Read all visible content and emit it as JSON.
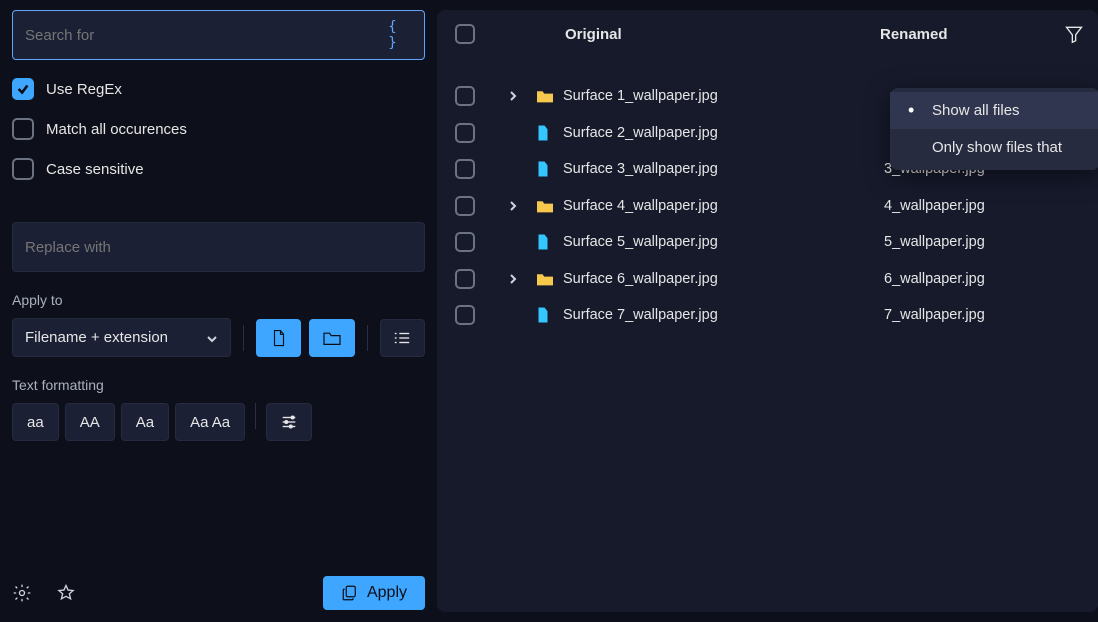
{
  "search": {
    "placeholder": "Search for"
  },
  "options": {
    "regex_label": "Use RegEx",
    "regex_checked": true,
    "matchall_label": "Match all occurences",
    "case_label": "Case sensitive"
  },
  "replace": {
    "placeholder": "Replace with"
  },
  "applyto": {
    "label": "Apply to",
    "value": "Filename + extension"
  },
  "textfmt": {
    "label": "Text formatting",
    "btns": [
      "aa",
      "AA",
      "Aa",
      "Aa Aa"
    ]
  },
  "header": {
    "original": "Original",
    "renamed": "Renamed"
  },
  "filter_menu": {
    "selected": "Show all files",
    "other": "Only show files that"
  },
  "rows": [
    {
      "folder": true,
      "chev": true,
      "orig": "Surface 1_wallpaper.jpg",
      "ren": ""
    },
    {
      "folder": false,
      "chev": false,
      "orig": "Surface 2_wallpaper.jpg",
      "ren": ""
    },
    {
      "folder": false,
      "chev": false,
      "orig": "Surface 3_wallpaper.jpg",
      "ren": "3_wallpaper.jpg"
    },
    {
      "folder": true,
      "chev": true,
      "orig": "Surface 4_wallpaper.jpg",
      "ren": "4_wallpaper.jpg"
    },
    {
      "folder": false,
      "chev": false,
      "orig": "Surface 5_wallpaper.jpg",
      "ren": "5_wallpaper.jpg"
    },
    {
      "folder": true,
      "chev": true,
      "orig": "Surface 6_wallpaper.jpg",
      "ren": "6_wallpaper.jpg"
    },
    {
      "folder": false,
      "chev": false,
      "orig": "Surface 7_wallpaper.jpg",
      "ren": "7_wallpaper.jpg"
    }
  ],
  "apply_button": "Apply"
}
